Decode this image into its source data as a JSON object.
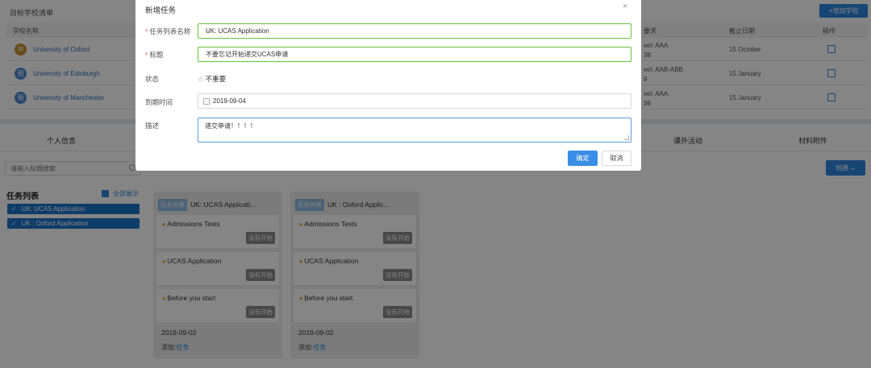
{
  "background": {
    "target_list": {
      "title": "目标学校清单",
      "add_button": "+增加学校",
      "columns": [
        "学校名称",
        "要求",
        "截止日期",
        "操作"
      ],
      "rows": [
        {
          "badge": "中",
          "badge_color": "#c8902e",
          "name": "University of Oxford",
          "req_line1": "vel: AAA",
          "req_line2": "38",
          "deadline": "15 October"
        },
        {
          "badge": "预",
          "badge_color": "#4a8ad1",
          "name": "University of Edinburgh",
          "req_line1": "vel: AAB-ABB",
          "req_line2": "9",
          "deadline": "15 January"
        },
        {
          "badge": "预",
          "badge_color": "#4a8ad1",
          "name": "University of Manchester",
          "req_line1": "vel: AAA",
          "req_line2": "36",
          "deadline": "15 January"
        }
      ]
    },
    "tabs": [
      "个人信息",
      "课外活动",
      "材料附件"
    ],
    "search_placeholder": "请输入标题搜索",
    "create_button": "创建",
    "task_lists": {
      "title": "任务列表",
      "show_all": "全部展示",
      "items": [
        "UK: UCAS Application",
        "UK : Oxford Application"
      ]
    },
    "columns": [
      {
        "label": "任务列表",
        "title": "UK: UCAS Applicati...",
        "cards": [
          {
            "name": "Admissions Tests",
            "status": "没有开始"
          },
          {
            "name": "UCAS Application",
            "status": "没有开始"
          },
          {
            "name": "Before you start",
            "status": "没有开始"
          }
        ],
        "date": "2019-09-02",
        "add_prefix": "添加:",
        "add_link": "任务"
      },
      {
        "label": "任务列表",
        "title": "UK : Oxford Applic...",
        "cards": [
          {
            "name": "Admissions Tests",
            "status": "没有开始"
          },
          {
            "name": "UCAS Application",
            "status": "没有开始"
          },
          {
            "name": "Before you start",
            "status": "没有开始"
          }
        ],
        "date": "2019-09-02",
        "add_prefix": "添加:",
        "add_link": "任务"
      }
    ]
  },
  "modal": {
    "title": "新增任务",
    "close": "×",
    "fields": {
      "list_label": "任务列表名称",
      "list_value": "UK: UCAS Application",
      "title_label": "标题",
      "title_value": "不要忘记开始递交UCAS申请",
      "status_label": "状态",
      "status_value": "不重要",
      "due_label": "到期时间",
      "due_value": "2019-09-04",
      "desc_label": "描述",
      "desc_value": "递交申请！！！！"
    },
    "ok_button": "确定",
    "cancel_button": "取消"
  },
  "colors": {
    "primary": "#2e86de",
    "valid_border": "#67c23a",
    "focus_border": "#5b9bd5",
    "required_star": "#f05050",
    "task_star": "#f29b1d",
    "status_badge": "#8a8a8a"
  }
}
